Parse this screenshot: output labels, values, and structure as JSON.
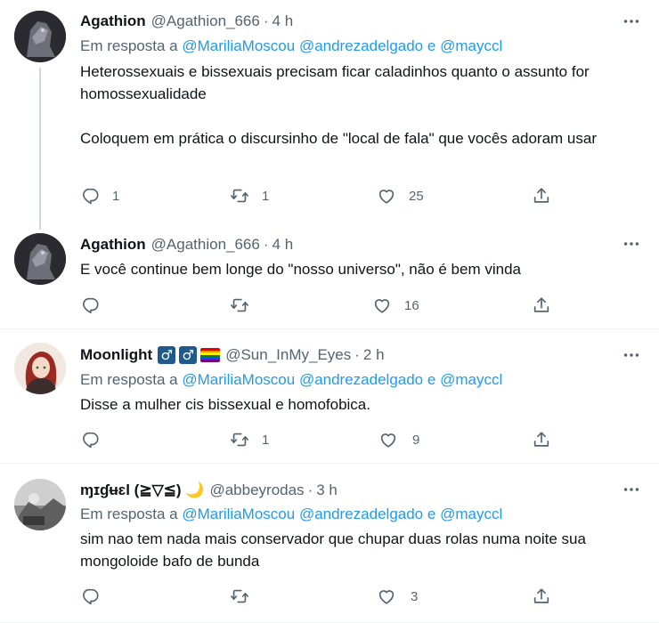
{
  "tweets": [
    {
      "name": "Agathion",
      "handle": "@Agathion_666",
      "time": "4 h",
      "reply_prefix": "Em resposta a",
      "reply_mentions": [
        "@MariliaMoscou",
        "@andrezadelgado",
        "@mayccl"
      ],
      "reply_joiner": "e",
      "text": "Heterossexuais e bissexuais precisam ficar caladinhos quanto o assunto for homossexualidade\n\nColoquem em prática o discursinho de \"local de fala\" que vocês adoram usar",
      "replies": "1",
      "retweets": "1",
      "likes": "25"
    },
    {
      "name": "Agathion",
      "handle": "@Agathion_666",
      "time": "4 h",
      "text": "E você continue bem longe do \"nosso universo\", não é bem vinda",
      "replies": "",
      "retweets": "",
      "likes": "16"
    },
    {
      "name": "Moonlight",
      "name_emojis": [
        "♂",
        "♂",
        "rainbow-flag"
      ],
      "handle": "@Sun_InMy_Eyes",
      "time": "2 h",
      "reply_prefix": "Em resposta a",
      "reply_mentions": [
        "@MariliaMoscou",
        "@andrezadelgado",
        "@mayccl"
      ],
      "reply_joiner": "e",
      "text": "Disse a mulher cis bissexual e homofobica.",
      "replies": "",
      "retweets": "1",
      "likes": "9"
    },
    {
      "name": "ɱɪɠʉɛl (≧▽≦) 🌙",
      "handle": "@abbeyrodas",
      "time": "3 h",
      "reply_prefix": "Em resposta a",
      "reply_mentions": [
        "@MariliaMoscou",
        "@andrezadelgado",
        "@mayccl"
      ],
      "reply_joiner": "e",
      "text": "sim nao tem nada mais conservador que chupar duas rolas numa noite sua mongoloide bafo de bunda",
      "replies": "",
      "retweets": "",
      "likes": "3"
    }
  ],
  "separator": "·",
  "icons": [
    "reply-icon",
    "retweet-icon",
    "like-icon",
    "share-icon",
    "more-icon"
  ],
  "colors": {
    "link": "#1d9bf0",
    "muted": "#536471",
    "text": "#0f1419",
    "badge": "#1e5a8c"
  }
}
